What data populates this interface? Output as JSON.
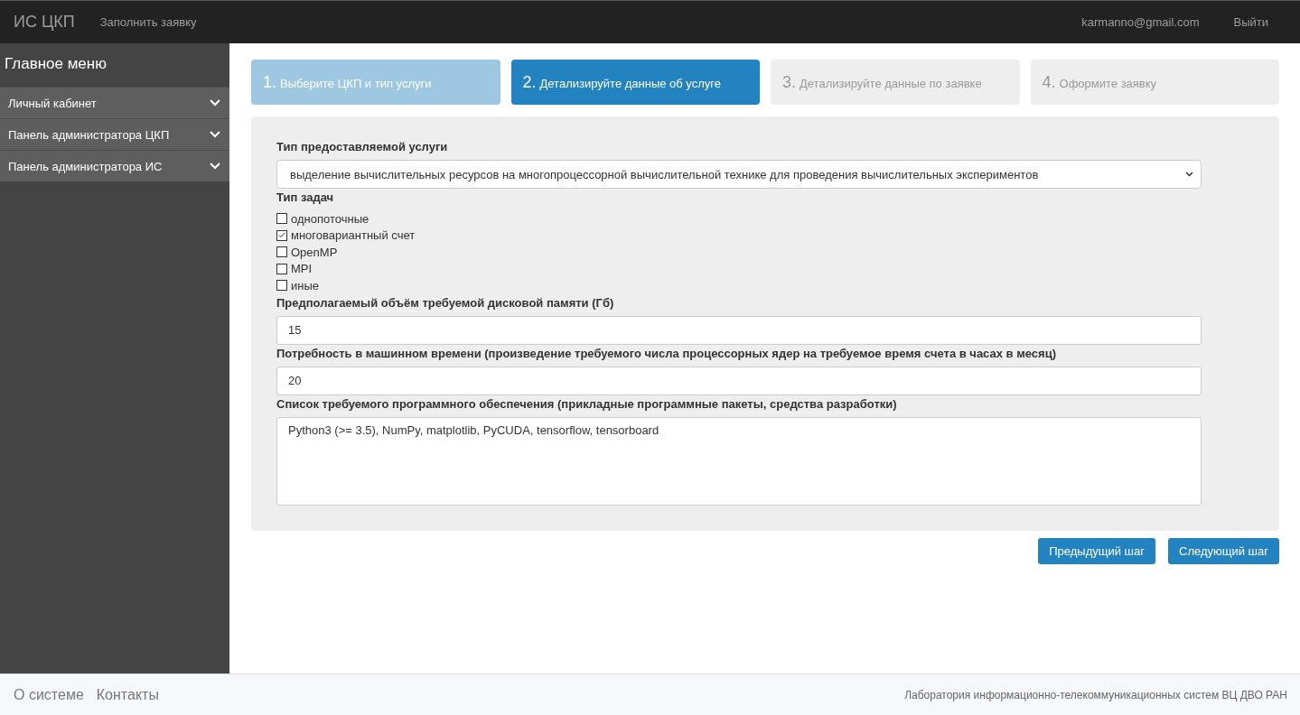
{
  "navbar": {
    "brand": "ИС ЦКП",
    "links": [
      "Заполнить заявку"
    ],
    "user": "karmanno@gmail.com",
    "logout": "Выйти"
  },
  "sidebar": {
    "title": "Главное меню",
    "items": [
      {
        "label": "Личный кабинет"
      },
      {
        "label": "Панель администратора ЦКП"
      },
      {
        "label": "Панель администратора ИС"
      }
    ]
  },
  "steps": [
    {
      "number": "1.",
      "label": "Выберите ЦКП и тип услуги",
      "selected": false,
      "completed": true
    },
    {
      "number": "2.",
      "label": "Детализируйте данные об услуге",
      "selected": true,
      "completed": false
    },
    {
      "number": "3.",
      "label": "Детализируйте данные по заявке",
      "selected": false,
      "completed": false
    },
    {
      "number": "4.",
      "label": "Оформите заявку",
      "selected": false,
      "completed": false
    }
  ],
  "form": {
    "service_type": {
      "label": "Тип предоставляемой услуги",
      "value": "выделение вычислительных ресурсов на многопроцессорной вычислительной технике для проведения вычислительных экспериментов"
    },
    "task_types": {
      "label": "Тип задач",
      "options": [
        {
          "label": "однопоточные",
          "checked": false
        },
        {
          "label": "многовариантный счет",
          "checked": true
        },
        {
          "label": "OpenMP",
          "checked": false
        },
        {
          "label": "MPI",
          "checked": false
        },
        {
          "label": "иные",
          "checked": false
        }
      ]
    },
    "disk": {
      "label": "Предполагаемый объём требуемой дисковой памяти (Гб)",
      "value": "15"
    },
    "machine_time": {
      "label": "Потребность в машинном времени (произведение требуемого числа процессорных ядер на требуемое время счета в часах в месяц)",
      "value": "20"
    },
    "software": {
      "label": "Список требуемого программного обеспечения (прикладные программные пакеты, средства разработки)",
      "value": "Python3 (>= 3.5), NumPy, matplotlib, PyCUDA, tensorflow, tensorboard"
    }
  },
  "buttons": [
    "Предыдущий шаг",
    "Следующий шаг"
  ],
  "footer": {
    "links": [
      "О системе",
      "Контакты"
    ],
    "credit": "Лаборатория информационно-телекоммуникационных систем ВЦ ДВО РАН"
  }
}
